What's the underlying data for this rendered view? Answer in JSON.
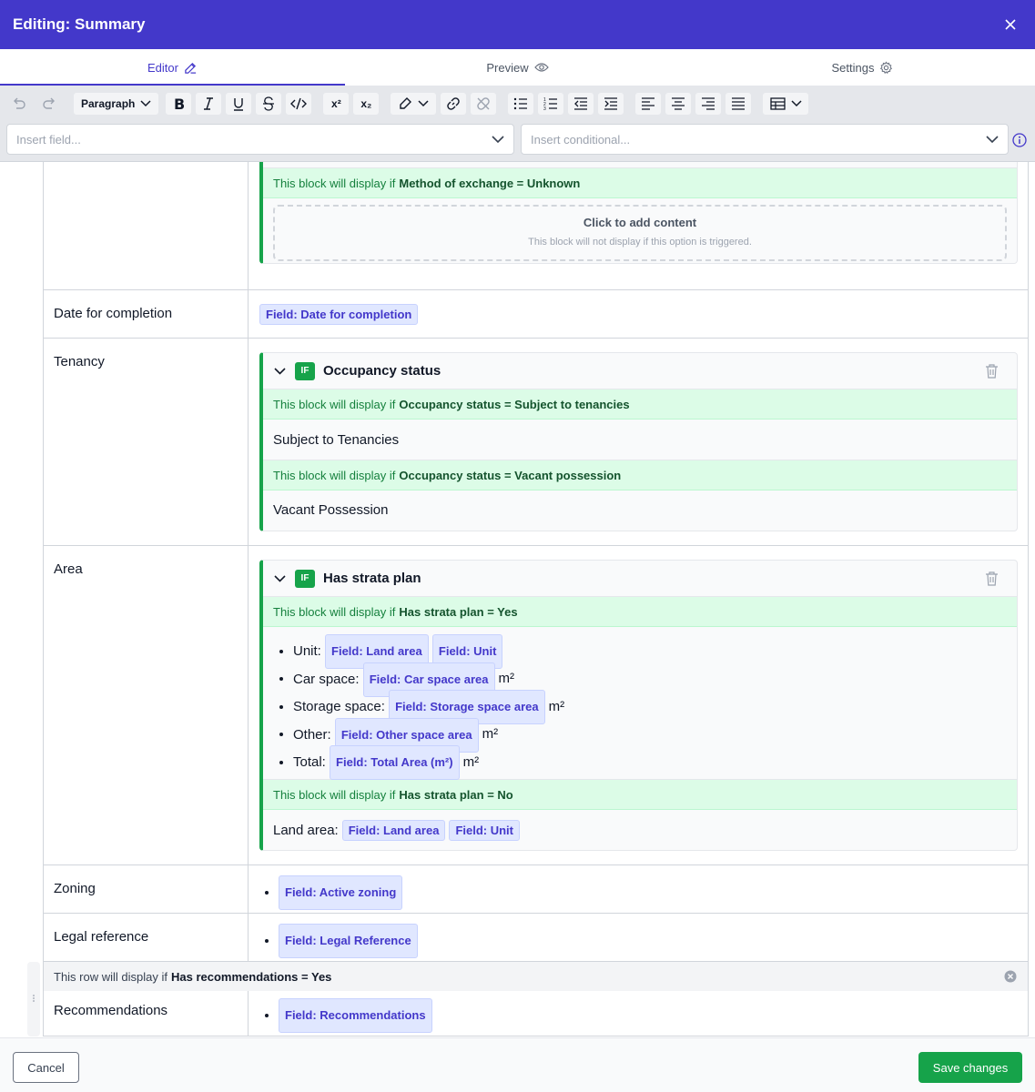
{
  "header": {
    "title": "Editing: Summary"
  },
  "tabs": [
    {
      "label": "Editor",
      "icon": "edit-icon",
      "active": true
    },
    {
      "label": "Preview",
      "icon": "eye-icon",
      "active": false
    },
    {
      "label": "Settings",
      "icon": "gear-icon",
      "active": false
    }
  ],
  "toolbar": {
    "block_format": "Paragraph",
    "insert_field_placeholder": "Insert field...",
    "insert_conditional_placeholder": "Insert conditional...",
    "superscript": "x²",
    "subscript": "x₂"
  },
  "rows": {
    "exchange": {
      "condition_prefix": "This block will display if",
      "condition": "Method of exchange = Unknown",
      "placeholder_title": "Click to add content",
      "placeholder_sub": "This block will not display if this option is triggered."
    },
    "completion": {
      "label": "Date for completion",
      "field": "Field: Date for completion"
    },
    "tenancy": {
      "label": "Tenancy",
      "block_title": "Occupancy status",
      "badge": "IF",
      "cond1_prefix": "This block will display if",
      "cond1": "Occupancy status = Subject to tenancies",
      "text1": "Subject to Tenancies",
      "cond2_prefix": "This block will display if",
      "cond2": "Occupancy status = Vacant possession",
      "text2": "Vacant Possession"
    },
    "area": {
      "label": "Area",
      "block_title": "Has strata plan",
      "badge": "IF",
      "cond1_prefix": "This block will display if",
      "cond1": "Has strata plan = Yes",
      "items": [
        {
          "label": "Unit:",
          "fields": [
            "Field: Land area",
            "Field: Unit"
          ],
          "unit": ""
        },
        {
          "label": "Car space:",
          "fields": [
            "Field: Car space area"
          ],
          "unit": "m²"
        },
        {
          "label": "Storage space:",
          "fields": [
            "Field: Storage space area"
          ],
          "unit": "m²"
        },
        {
          "label": "Other:",
          "fields": [
            "Field: Other space area"
          ],
          "unit": "m²"
        },
        {
          "label": "Total:",
          "fields": [
            "Field: Total Area (m²)"
          ],
          "unit": "m²"
        }
      ],
      "cond2_prefix": "This block will display if",
      "cond2": "Has strata plan = No",
      "land_label": "Land area:",
      "land_field1": "Field: Land area",
      "land_field2": "Field: Unit"
    },
    "zoning": {
      "label": "Zoning",
      "field": "Field: Active zoning"
    },
    "legal": {
      "label": "Legal reference",
      "field": "Field: Legal Reference"
    },
    "recommendations": {
      "row_cond_prefix": "This row will display if",
      "row_cond": "Has recommendations = Yes",
      "label": "Recommendations",
      "field": "Field: Recommendations"
    }
  },
  "footer": {
    "cancel": "Cancel",
    "save": "Save changes"
  },
  "colors": {
    "header": "#4338ca",
    "accent_green": "#16a34a",
    "chip_bg": "#e0e7ff"
  }
}
